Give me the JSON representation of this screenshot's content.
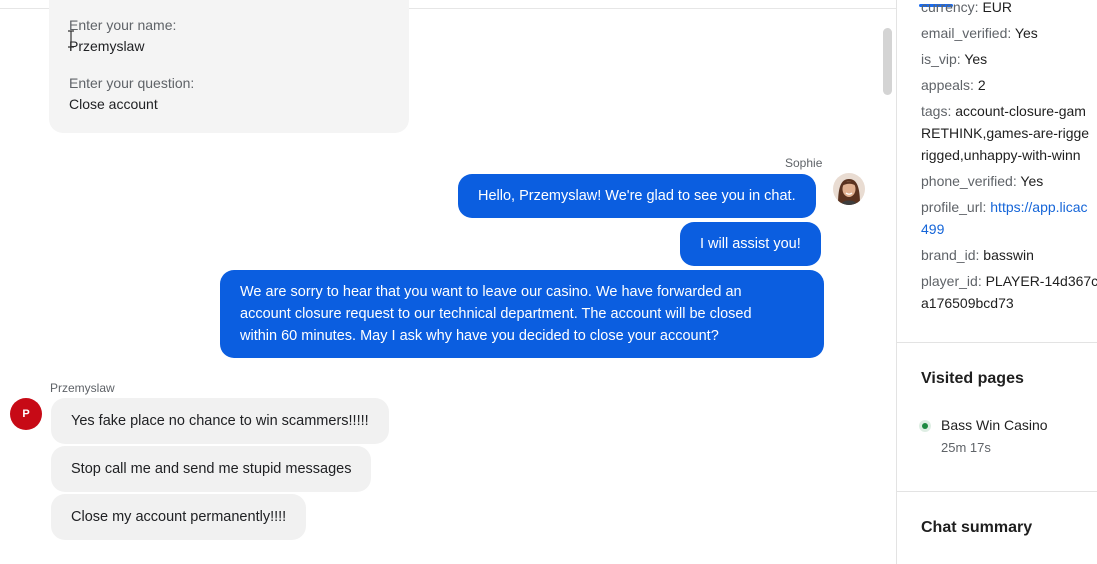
{
  "form": {
    "name_label": "Enter your name:",
    "name_value": "Przemyslaw",
    "question_label": "Enter your question:",
    "question_value": "Close account"
  },
  "agent": {
    "name": "Sophie",
    "messages": [
      "Hello, Przemyslaw! We're glad to see you in chat.",
      "I will assist you!",
      "We are sorry to hear that you want to leave our casino. We have forwarded an",
      "account closure request to our technical department. The account will be closed",
      "within 60 minutes. May I ask why have you decided to close your account?"
    ]
  },
  "user": {
    "name": "Przemyslaw",
    "avatar_letter": "P",
    "messages": [
      "Yes fake place no chance to win scammers!!!!!",
      "Stop call me and send me stupid messages",
      "Close my account permanently!!!!"
    ]
  },
  "details": {
    "currency_key": "currency:",
    "currency_val": "EUR",
    "email_verified_key": "email_verified:",
    "email_verified_val": "Yes",
    "is_vip_key": "is_vip:",
    "is_vip_val": "Yes",
    "appeals_key": "appeals:",
    "appeals_val": "2",
    "tags_key": "tags:",
    "tags_line1": "account-closure-gam",
    "tags_line2": "RETHINK,games-are-rigge",
    "tags_line3": "rigged,unhappy-with-winn",
    "phone_verified_key": "phone_verified:",
    "phone_verified_val": "Yes",
    "profile_url_key": "profile_url:",
    "profile_url_line1": "https://app.licac",
    "profile_url_line2": "499",
    "brand_id_key": "brand_id:",
    "brand_id_val": "basswin",
    "player_id_key": "player_id:",
    "player_id_line1": "PLAYER-14d367c",
    "player_id_line2": "a176509bcd73"
  },
  "visited": {
    "title": "Visited pages",
    "page_name": "Bass Win Casino",
    "page_time": "25m 17s"
  },
  "summary": {
    "title": "Chat summary"
  },
  "colors": {
    "agent_bubble": "#0b5ee0",
    "user_bubble": "#f1f1f1",
    "user_avatar": "#c70a16",
    "online_dot": "#1e8a42",
    "link": "#1565d8"
  }
}
